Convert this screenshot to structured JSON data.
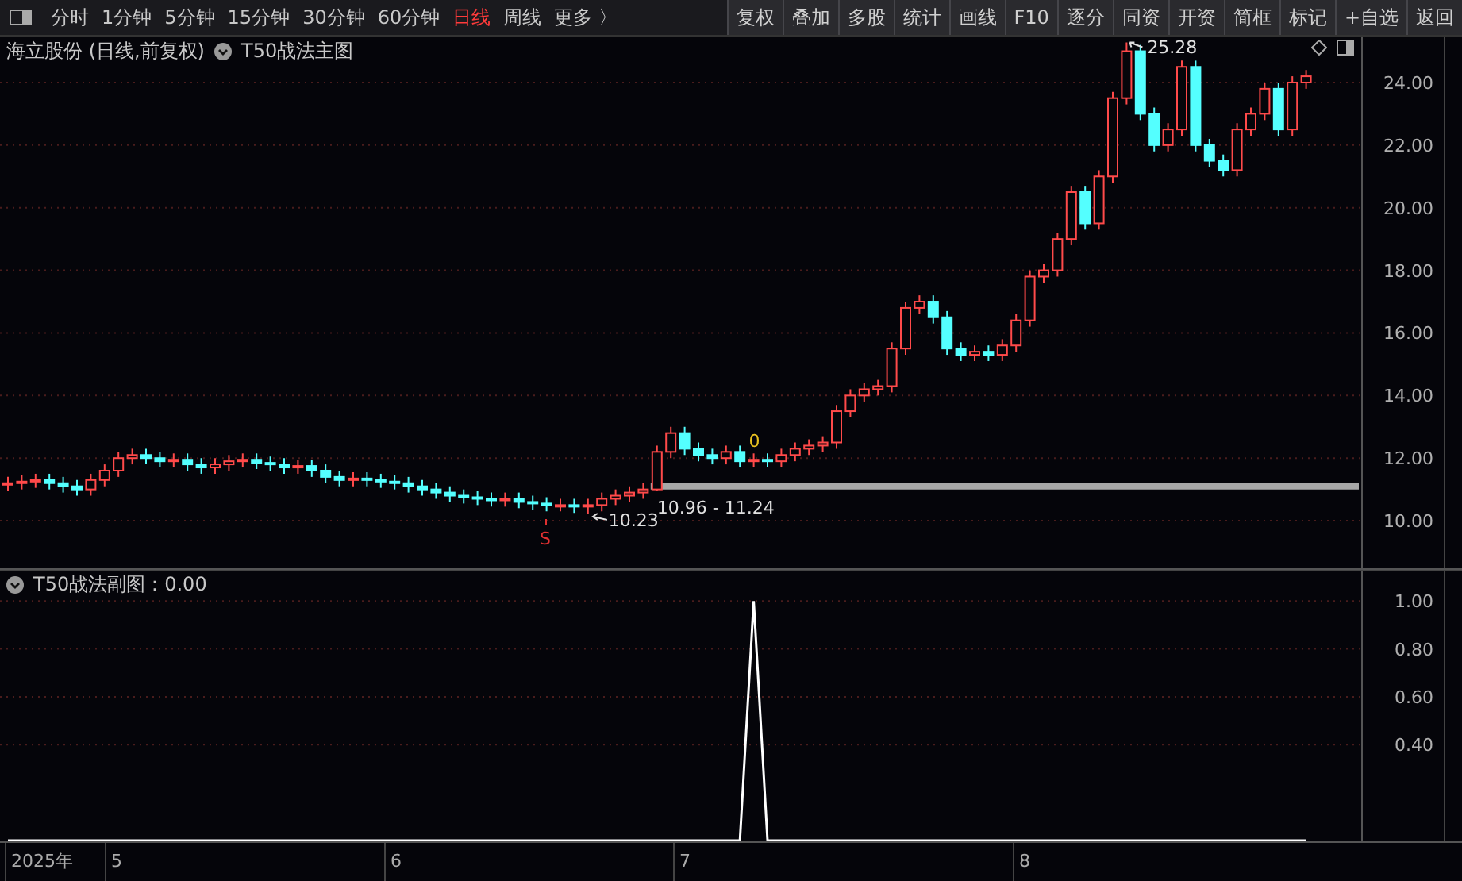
{
  "toolbar": {
    "periods": [
      {
        "label": "分时",
        "selected": false
      },
      {
        "label": "1分钟",
        "selected": false
      },
      {
        "label": "5分钟",
        "selected": false
      },
      {
        "label": "15分钟",
        "selected": false
      },
      {
        "label": "30分钟",
        "selected": false
      },
      {
        "label": "60分钟",
        "selected": false
      },
      {
        "label": "日线",
        "selected": true
      },
      {
        "label": "周线",
        "selected": false
      }
    ],
    "more": "更多 〉",
    "buttons": [
      "复权",
      "叠加",
      "多股",
      "统计",
      "画线",
      "F10",
      "逐分",
      "同资",
      "开资",
      "简框",
      "标记",
      "+自选",
      "返回"
    ]
  },
  "main_chart": {
    "stock": "海立股份 (日线,前复权)",
    "indicator": "T50战法主图",
    "high_label": "25.28",
    "low_label": "10.23",
    "range_label": "10.96 - 11.24",
    "buy_mark": "S",
    "signal_mark": "0",
    "chart_data": {
      "type": "candlestick",
      "grid": true,
      "ylim": [
        8.43,
        25.47
      ],
      "ref_lines": [
        {
          "axis": "y",
          "value": 11.1
        }
      ],
      "yticks": [
        {
          "value": 24,
          "label": "24.00"
        },
        {
          "value": 22,
          "label": "22.00"
        },
        {
          "value": 20,
          "label": "20.00"
        },
        {
          "value": 18,
          "label": "18.00"
        },
        {
          "value": 16,
          "label": "16.00"
        },
        {
          "value": 14,
          "label": "14.00"
        },
        {
          "value": 12,
          "label": "12.00"
        },
        {
          "value": 10,
          "label": "10.00"
        }
      ],
      "ohlc": [
        [
          11.15,
          11.4,
          10.95,
          11.2
        ],
        [
          11.2,
          11.45,
          11.0,
          11.25
        ],
        [
          11.25,
          11.5,
          11.05,
          11.3
        ],
        [
          11.3,
          11.5,
          11.0,
          11.2
        ],
        [
          11.2,
          11.4,
          10.9,
          11.1
        ],
        [
          11.1,
          11.3,
          10.8,
          11.0
        ],
        [
          11.0,
          11.5,
          10.8,
          11.3
        ],
        [
          11.3,
          11.8,
          11.1,
          11.6
        ],
        [
          11.6,
          12.2,
          11.4,
          12.0
        ],
        [
          12.0,
          12.3,
          11.8,
          12.1
        ],
        [
          12.1,
          12.3,
          11.8,
          12.0
        ],
        [
          12.0,
          12.2,
          11.7,
          11.9
        ],
        [
          11.9,
          12.15,
          11.7,
          11.95
        ],
        [
          11.95,
          12.15,
          11.6,
          11.8
        ],
        [
          11.8,
          12.0,
          11.5,
          11.7
        ],
        [
          11.7,
          12.0,
          11.5,
          11.8
        ],
        [
          11.8,
          12.1,
          11.6,
          11.9
        ],
        [
          11.9,
          12.15,
          11.7,
          11.95
        ],
        [
          11.95,
          12.15,
          11.65,
          11.85
        ],
        [
          11.85,
          12.05,
          11.6,
          11.8
        ],
        [
          11.8,
          12.0,
          11.5,
          11.7
        ],
        [
          11.7,
          11.95,
          11.5,
          11.75
        ],
        [
          11.75,
          11.95,
          11.4,
          11.6
        ],
        [
          11.6,
          11.8,
          11.2,
          11.4
        ],
        [
          11.4,
          11.6,
          11.1,
          11.3
        ],
        [
          11.3,
          11.55,
          11.1,
          11.35
        ],
        [
          11.35,
          11.55,
          11.1,
          11.3
        ],
        [
          11.3,
          11.5,
          11.05,
          11.25
        ],
        [
          11.25,
          11.45,
          11.0,
          11.2
        ],
        [
          11.2,
          11.4,
          10.9,
          11.1
        ],
        [
          11.1,
          11.3,
          10.8,
          11.0
        ],
        [
          11.0,
          11.2,
          10.7,
          10.9
        ],
        [
          10.9,
          11.1,
          10.6,
          10.8
        ],
        [
          10.8,
          11.0,
          10.55,
          10.75
        ],
        [
          10.75,
          10.95,
          10.5,
          10.7
        ],
        [
          10.7,
          10.9,
          10.45,
          10.65
        ],
        [
          10.65,
          10.9,
          10.45,
          10.7
        ],
        [
          10.7,
          10.9,
          10.4,
          10.6
        ],
        [
          10.6,
          10.8,
          10.35,
          10.55
        ],
        [
          10.55,
          10.75,
          10.3,
          10.5
        ],
        [
          10.5,
          10.7,
          10.3,
          10.5
        ],
        [
          10.5,
          10.7,
          10.25,
          10.45
        ],
        [
          10.45,
          10.7,
          10.23,
          10.5
        ],
        [
          10.5,
          10.9,
          10.3,
          10.7
        ],
        [
          10.7,
          11.0,
          10.5,
          10.8
        ],
        [
          10.8,
          11.1,
          10.6,
          10.9
        ],
        [
          10.9,
          11.2,
          10.7,
          11.0
        ],
        [
          11.0,
          12.4,
          10.96,
          12.2
        ],
        [
          12.2,
          13.0,
          12.0,
          12.8
        ],
        [
          12.8,
          13.0,
          12.1,
          12.3
        ],
        [
          12.3,
          12.5,
          11.9,
          12.1
        ],
        [
          12.1,
          12.3,
          11.8,
          12.0
        ],
        [
          12.0,
          12.4,
          11.8,
          12.2
        ],
        [
          12.2,
          12.4,
          11.7,
          11.9
        ],
        [
          11.9,
          12.15,
          11.7,
          11.95
        ],
        [
          11.95,
          12.15,
          11.7,
          11.9
        ],
        [
          11.9,
          12.3,
          11.7,
          12.1
        ],
        [
          12.1,
          12.5,
          11.9,
          12.3
        ],
        [
          12.3,
          12.6,
          12.1,
          12.4
        ],
        [
          12.4,
          12.7,
          12.2,
          12.5
        ],
        [
          12.5,
          13.7,
          12.3,
          13.5
        ],
        [
          13.5,
          14.2,
          13.3,
          14.0
        ],
        [
          14.0,
          14.4,
          13.8,
          14.2
        ],
        [
          14.2,
          14.5,
          14.0,
          14.3
        ],
        [
          14.3,
          15.7,
          14.1,
          15.5
        ],
        [
          15.5,
          17.0,
          15.3,
          16.8
        ],
        [
          16.8,
          17.2,
          16.6,
          17.0
        ],
        [
          17.0,
          17.2,
          16.3,
          16.5
        ],
        [
          16.5,
          16.7,
          15.3,
          15.5
        ],
        [
          15.5,
          15.7,
          15.1,
          15.3
        ],
        [
          15.3,
          15.6,
          15.1,
          15.4
        ],
        [
          15.4,
          15.6,
          15.1,
          15.3
        ],
        [
          15.3,
          15.8,
          15.1,
          15.6
        ],
        [
          15.6,
          16.6,
          15.4,
          16.4
        ],
        [
          16.4,
          18.0,
          16.2,
          17.8
        ],
        [
          17.8,
          18.2,
          17.6,
          18.0
        ],
        [
          18.0,
          19.2,
          17.8,
          19.0
        ],
        [
          19.0,
          20.7,
          18.8,
          20.5
        ],
        [
          20.5,
          20.7,
          19.3,
          19.5
        ],
        [
          19.5,
          21.2,
          19.3,
          21.0
        ],
        [
          21.0,
          23.7,
          20.8,
          23.5
        ],
        [
          23.5,
          25.28,
          23.3,
          25.0
        ],
        [
          25.0,
          25.2,
          22.8,
          23.0
        ],
        [
          23.0,
          23.2,
          21.8,
          22.0
        ],
        [
          22.0,
          22.7,
          21.8,
          22.5
        ],
        [
          22.5,
          24.7,
          22.3,
          24.5
        ],
        [
          24.5,
          24.7,
          21.8,
          22.0
        ],
        [
          22.0,
          22.2,
          21.3,
          21.5
        ],
        [
          21.5,
          21.7,
          21.0,
          21.2
        ],
        [
          21.2,
          22.7,
          21.0,
          22.5
        ],
        [
          22.5,
          23.2,
          22.3,
          23.0
        ],
        [
          23.0,
          24.0,
          22.8,
          23.8
        ],
        [
          23.8,
          24.0,
          22.3,
          22.5
        ],
        [
          22.5,
          24.2,
          22.3,
          24.0
        ],
        [
          24.0,
          24.4,
          23.8,
          24.2
        ]
      ]
    }
  },
  "sub_chart": {
    "reading": "：0.00",
    "chart_data": {
      "type": "line",
      "grid": true,
      "ylim": [
        -0.01,
        1.13
      ],
      "yticks": [
        {
          "value": 0.4,
          "label": "0.40"
        },
        {
          "value": 0.6,
          "label": "0.60"
        },
        {
          "value": 0.8,
          "label": "0.80"
        },
        {
          "value": 1.0,
          "label": "1.00"
        }
      ],
      "series": [
        {
          "name": "T50战法副图",
          "color": "#ffffff",
          "values": [
            0,
            0,
            0,
            0,
            0,
            0,
            0,
            0,
            0,
            0,
            0,
            0,
            0,
            0,
            0,
            0,
            0,
            0,
            0,
            0,
            0,
            0,
            0,
            0,
            0,
            0,
            0,
            0,
            0,
            0,
            0,
            0,
            0,
            0,
            0,
            0,
            0,
            0,
            0,
            0,
            0,
            0,
            0,
            0,
            0,
            0,
            0,
            0,
            0,
            0,
            0,
            0,
            0,
            0,
            1,
            0,
            0,
            0,
            0,
            0,
            0,
            0,
            0,
            0,
            0,
            0,
            0,
            0,
            0,
            0,
            0,
            0,
            0,
            0,
            0,
            0,
            0,
            0,
            0,
            0,
            0,
            0,
            0,
            0,
            0,
            0,
            0,
            0,
            0,
            0,
            0,
            0,
            0,
            0,
            0
          ]
        }
      ]
    }
  },
  "date_axis": [
    "2025年",
    "5",
    "6",
    "7",
    "8"
  ]
}
